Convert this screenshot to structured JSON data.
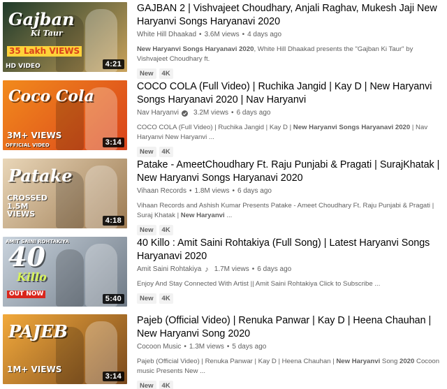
{
  "videos": [
    {
      "title": "GAJBAN 2 | Vishvajeet Choudhary, Anjali Raghav, Mukesh Jaji New Haryanvi Songs Haryanavi 2020",
      "channel": "White Hill Dhaakad",
      "channel_badge": "",
      "views": "3.6M views",
      "age": "4 days ago",
      "desc_html": "<b>New Haryanvi Songs Haryanavi 2020</b>, White Hill Dhaakad presents the \"Gajban Ki Taur\" by Vishvajeet Choudhary ft.",
      "badges": [
        "New",
        "4K"
      ],
      "duration": "4:21",
      "thumb": {
        "word": "Gajban",
        "sub": "Ki Taur",
        "tag": "35 Lakh VIEWS",
        "tag2": "HD VIDEO",
        "bg": [
          "#1f3a2a",
          "#c9a25b"
        ]
      }
    },
    {
      "title": "COCO COLA (Full Video) | Ruchika Jangid | Kay D | New Haryanvi Songs Haryanavi 2020 | Nav Haryanvi",
      "channel": "Nav Haryanvi",
      "channel_badge": "verified",
      "views": "3.2M views",
      "age": "6 days ago",
      "desc_html": "COCO COLA (Full Video) | Ruchika Jangid | Kay D | <b>New Haryanvi Songs Haryanavi 2020</b> | Nav Haryanvi New Haryanvi ...",
      "badges": [
        "New",
        "4K"
      ],
      "duration": "3:14",
      "thumb": {
        "word": "Coco Cola",
        "sub": "",
        "tag": "3M+ VIEWS",
        "tag2": "OFFICIAL VIDEO",
        "bg": [
          "#f28a1c",
          "#d9431b"
        ]
      }
    },
    {
      "title": "Patake - AmeetChoudhary Ft. Raju Punjabi & Pragati | SurajKhatak | New Haryanvi Songs Haryanavi 2020",
      "channel": "Vihaan Records",
      "channel_badge": "",
      "views": "1.8M views",
      "age": "6 days ago",
      "desc_html": "Vihaan Records and Ashish Kumar Presents Patake - Ameet Choudhary Ft. Raju Punjabi & Pragati | Suraj Khatak | <b>New Haryanvi</b> ...",
      "badges": [
        "New",
        "4K"
      ],
      "duration": "4:18",
      "thumb": {
        "word": "Patake",
        "sub": "",
        "tag": "CROSSED 1.5M VIEWS",
        "tag2": "",
        "bg": [
          "#e9d6b8",
          "#9c7a52"
        ]
      }
    },
    {
      "title": "40 Killo : Amit Saini Rohtakiya (Full Song) | Latest Haryanvi Songs Haryanavi 2020",
      "channel": "Amit Saini Rohtakiya",
      "channel_badge": "music",
      "views": "1.7M views",
      "age": "6 days ago",
      "desc_html": "Enjoy And Stay Connected With Artist || Amit Saini Rohtakiya Click to Subscribe ...",
      "badges": [
        "New",
        "4K"
      ],
      "duration": "5:40",
      "thumb": {
        "word": "40",
        "sub": "Killo",
        "tag": "OUT NOW",
        "tag2": "AMIT SAINI ROHTAKIYA",
        "bg": [
          "#c9d3dd",
          "#6f7a86"
        ]
      }
    },
    {
      "title": "Pajeb (Official Video) | Renuka Panwar | Kay D | Heena Chauhan | New Haryanvi Song 2020",
      "channel": "Cocoon Music",
      "channel_badge": "",
      "views": "1.3M views",
      "age": "5 days ago",
      "desc_html": "Pajeb (Official Video) | Renuka Panwar | Kay D | Heena Chauhan | <b>New Haryanvi</b> Song <b>2020</b> Cocoon music Presents New ...",
      "badges": [
        "New",
        "4K"
      ],
      "duration": "3:14",
      "thumb": {
        "word": "PAJEB",
        "sub": "",
        "tag": "1M+ VIEWS",
        "tag2": "",
        "bg": [
          "#f2a93b",
          "#7a4a1e"
        ]
      }
    }
  ]
}
